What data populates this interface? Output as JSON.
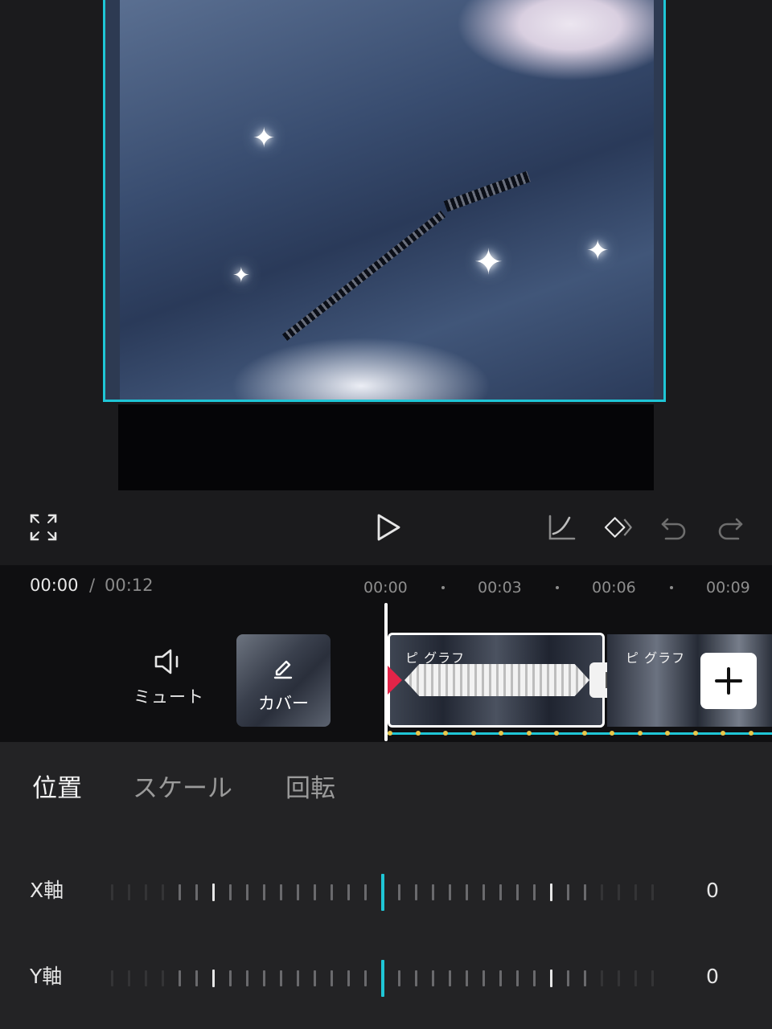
{
  "toolbar": {
    "icons": [
      "fullscreen-icon",
      "play-icon",
      "curve-graph-icon",
      "keyframe-icon",
      "undo-icon",
      "redo-icon"
    ]
  },
  "timeline": {
    "current_time": "00:00",
    "separator": "/",
    "total_time": "00:12",
    "ruler": [
      "00:00",
      "00:03",
      "00:06",
      "00:09"
    ],
    "mute_label": "ミュート",
    "cover_label": "カバー",
    "clip1_label": "ピ グラフ",
    "clip2_label": "ピ グラフ"
  },
  "panel": {
    "tabs": [
      {
        "label": "位置",
        "active": true
      },
      {
        "label": "スケール",
        "active": false
      },
      {
        "label": "回転",
        "active": false
      }
    ],
    "x_axis": {
      "label": "X軸",
      "value": "0"
    },
    "y_axis": {
      "label": "Y軸",
      "value": "0"
    }
  },
  "colors": {
    "accent": "#1fc6d6",
    "keyframe": "#e8c64a",
    "marker": "#e32448",
    "background": "#1b1b1d"
  }
}
